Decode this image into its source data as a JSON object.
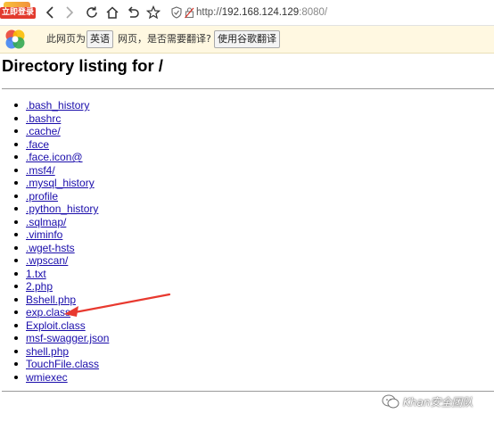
{
  "browser": {
    "login_badge": "立即登录",
    "url": {
      "scheme": "http://",
      "host": "192.168.124.129",
      "port": ":8080/"
    }
  },
  "translate_bar": {
    "prefix": "此网页为",
    "language": "英语",
    "suffix": "网页，是否需要翻译?",
    "button_label": "使用谷歌翻译"
  },
  "page": {
    "title": "Directory listing for /",
    "files": [
      ".bash_history",
      ".bashrc",
      ".cache/",
      ".face",
      ".face.icon@",
      ".msf4/",
      ".mysql_history",
      ".profile",
      ".python_history",
      ".sqlmap/",
      ".viminfo",
      ".wget-hsts",
      ".wpscan/",
      "1.txt",
      "2.php",
      "Bshell.php",
      "exp.class",
      "Exploit.class",
      "msf-swagger.json",
      "shell.php",
      "TouchFile.class",
      "wmiexec"
    ]
  },
  "annotation": {
    "color": "#e8392f"
  },
  "watermark": {
    "text": "Khan安全团队"
  }
}
